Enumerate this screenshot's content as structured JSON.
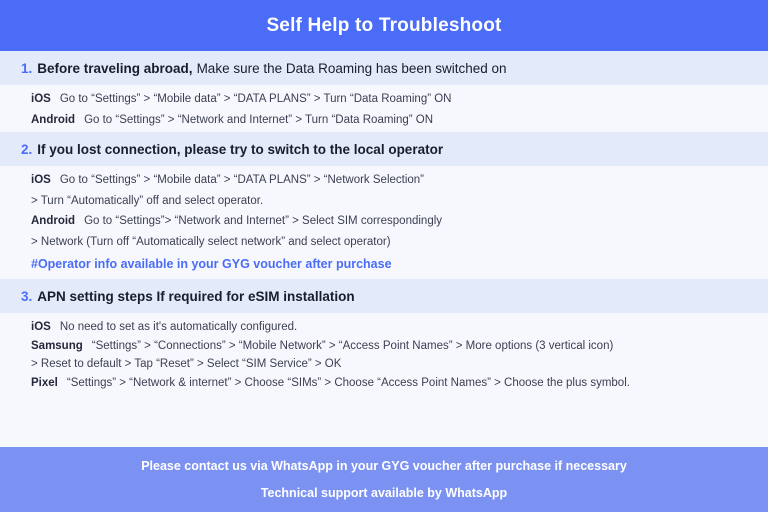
{
  "header": {
    "title": "Self Help to Troubleshoot",
    "background_color": "#4a6cf7",
    "text_color": "#ffffff"
  },
  "colors": {
    "page_background": "#f7f8fd",
    "section_band": "#e3eaf9",
    "accent_blue": "#4a6cf7",
    "footer_background": "#7b92f2",
    "body_text": "#3a3f52",
    "label_text": "#24283a"
  },
  "sections": [
    {
      "number": "1.",
      "heading_bold": "Before traveling abroad,",
      "heading_rest": "Make sure the Data Roaming has been switched on",
      "rows": [
        {
          "label": "iOS",
          "text": "Go to “Settings” > “Mobile data” > “DATA PLANS” > Turn “Data Roaming” ON"
        },
        {
          "label": "Android",
          "text": "Go to “Settings” > “Network and Internet” > Turn “Data Roaming” ON"
        }
      ],
      "continuations": [],
      "note": ""
    },
    {
      "number": "2.",
      "heading_bold": "If you lost connection, please try to switch to the local operator",
      "heading_rest": "",
      "rows": [
        {
          "label": "iOS",
          "text": "Go to “Settings” > “Mobile data” > “DATA PLANS” > “Network Selection”"
        }
      ],
      "cont_1": "> Turn “Automatically” off and select operator.",
      "rows2": [
        {
          "label": "Android",
          "text": "Go to “Settings”>  “Network and Internet” > Select SIM correspondingly"
        }
      ],
      "cont_2": "> Network (Turn off “Automatically select network” and select operator)",
      "note": "#Operator info available in your GYG voucher after purchase"
    },
    {
      "number": "3.",
      "heading_bold": "APN setting steps If required for eSIM installation",
      "heading_rest": "",
      "rows": [
        {
          "label": "iOS",
          "text": "No need to set as it's automatically configured."
        },
        {
          "label": "Samsung",
          "text": "“Settings” > “Connections” > “Mobile Network” > “Access Point Names” > More options (3 vertical icon)"
        }
      ],
      "cont_1": "> Reset to default > Tap “Reset” > Select “SIM Service” > OK",
      "rows2": [
        {
          "label": "Pixel",
          "text": "“Settings” > “Network & internet” > Choose “SIMs” > Choose “Access Point Names” > Choose the plus symbol."
        }
      ]
    }
  ],
  "footer": {
    "line1": "Please contact us via WhatsApp  in your GYG voucher after purchase if necessary",
    "line2": "Technical support available by WhatsApp"
  }
}
